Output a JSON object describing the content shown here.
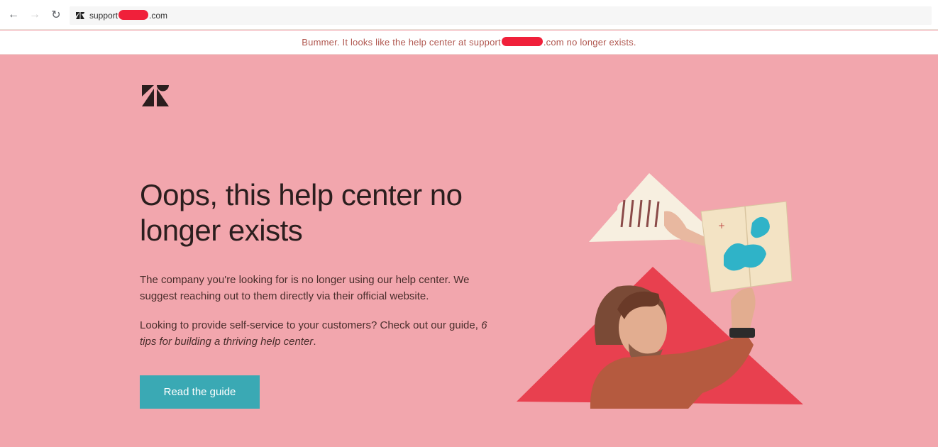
{
  "browser": {
    "back_icon": "arrow-left-icon",
    "forward_icon": "arrow-right-icon",
    "reload_icon": "reload-icon",
    "back_glyph": "←",
    "forward_glyph": "→",
    "reload_glyph": "↻",
    "url_prefix": "support",
    "url_suffix": ".com"
  },
  "notice": {
    "text_before": "Bummer. It looks like the help center at support",
    "text_after": ".com no longer exists."
  },
  "page": {
    "logo_icon": "zendesk-logo",
    "headline": "Oops, this help center no longer exists",
    "paragraph1": "The company you're looking for is no longer using our help center. We suggest reaching out to them directly via their official website.",
    "paragraph2_prefix": "Looking to provide self-service to your customers? Check out our guide, ",
    "guide_link": "6 tips for building a thriving help center",
    "paragraph2_suffix": ".",
    "cta_label": "Read the guide"
  },
  "colors": {
    "background": "#f2a6ad",
    "cta": "#3aa9b4",
    "redaction": "#f0203a",
    "notice_text": "#b0574f",
    "triangle_red": "#e8404f",
    "triangle_cream": "#f7efe0"
  }
}
